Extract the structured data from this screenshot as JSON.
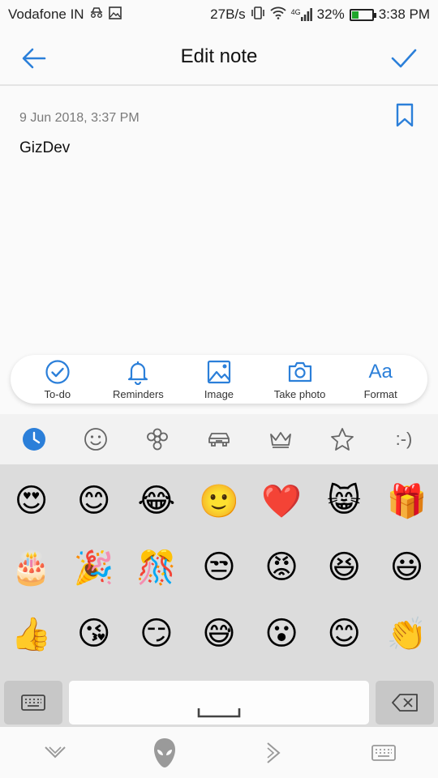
{
  "status_bar": {
    "carrier": "Vodafone IN",
    "speed": "27B/s",
    "network": "4G",
    "battery": "32%",
    "battery_level": 0.32,
    "time": "3:38 PM"
  },
  "header": {
    "title": "Edit note"
  },
  "note": {
    "date": "9 Jun 2018, 3:37 PM",
    "body": "GizDev"
  },
  "toolbar": {
    "items": [
      {
        "label": "To-do",
        "icon": "check-circle-icon"
      },
      {
        "label": "Reminders",
        "icon": "bell-icon"
      },
      {
        "label": "Image",
        "icon": "image-icon"
      },
      {
        "label": "Take photo",
        "icon": "camera-icon"
      },
      {
        "label": "Format",
        "icon": "format-text-icon",
        "glyph": "Aa"
      }
    ]
  },
  "emoji_tabs": {
    "items": [
      "recent-clock-icon",
      "smiley-icon",
      "flower-icon",
      "car-icon",
      "crown-icon",
      "star-icon",
      "emoticon-text"
    ],
    "emoticon_text": ":-)"
  },
  "emojis": [
    "😍",
    "😊",
    "😂",
    "🙂",
    "❤️",
    "😸",
    "🎁",
    "🎂",
    "🎉",
    "🎊",
    "😒",
    "😡",
    "😆",
    "😃",
    "👍",
    "😘",
    "😏",
    "😅",
    "😮",
    "😊",
    "👏"
  ],
  "colors": {
    "accent": "#2b7fd9",
    "battery_fill": "#1fa52b",
    "emoji_panel_bg": "#dcdcdc"
  }
}
